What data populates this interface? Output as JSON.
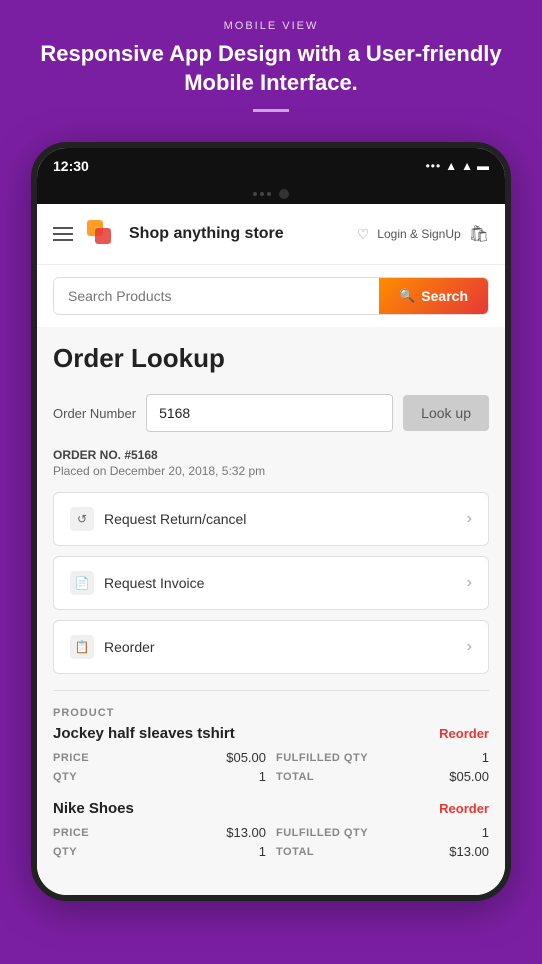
{
  "page": {
    "background_color": "#7B1FA2"
  },
  "header": {
    "label": "MOBILE VIEW",
    "headline": "Responsive App Design with a User-friendly Mobile Interface."
  },
  "status_bar": {
    "time": "12:30",
    "icons": [
      "...",
      "wifi",
      "signal",
      "battery"
    ]
  },
  "nav": {
    "store_name": "Shop anything store",
    "login_label": "Login & SignUp"
  },
  "search": {
    "placeholder": "Search Products",
    "button_label": "Search"
  },
  "main": {
    "title": "Order Lookup",
    "order_number_label": "Order Number",
    "order_number_value": "5168",
    "lookup_button_label": "Look up",
    "order_no_text": "ORDER NO. #5168",
    "order_placed_text": "Placed on December 20, 2018, 5:32 pm",
    "actions": [
      {
        "id": "return-cancel",
        "label": "Request Return/cancel",
        "icon": "↺"
      },
      {
        "id": "invoice",
        "label": "Request Invoice",
        "icon": "📄"
      },
      {
        "id": "reorder",
        "label": "Reorder",
        "icon": "📋"
      }
    ],
    "product_section_label": "PRODUCT",
    "products": [
      {
        "name": "Jockey half sleaves tshirt",
        "reorder_label": "Reorder",
        "price_label": "PRICE",
        "price_value": "$05.00",
        "qty_label": "QTY",
        "qty_value": "1",
        "fulfilled_qty_label": "FULFILLED QTY",
        "fulfilled_qty_value": "1",
        "total_label": "TOTAL",
        "total_value": "$05.00"
      },
      {
        "name": "Nike Shoes",
        "reorder_label": "Reorder",
        "price_label": "PRICE",
        "price_value": "$13.00",
        "qty_label": "QTY",
        "qty_value": "1",
        "fulfilled_qty_label": "FULFILLED QTY",
        "fulfilled_qty_value": "1",
        "total_label": "TOTAL",
        "total_value": "$13.00"
      }
    ]
  }
}
